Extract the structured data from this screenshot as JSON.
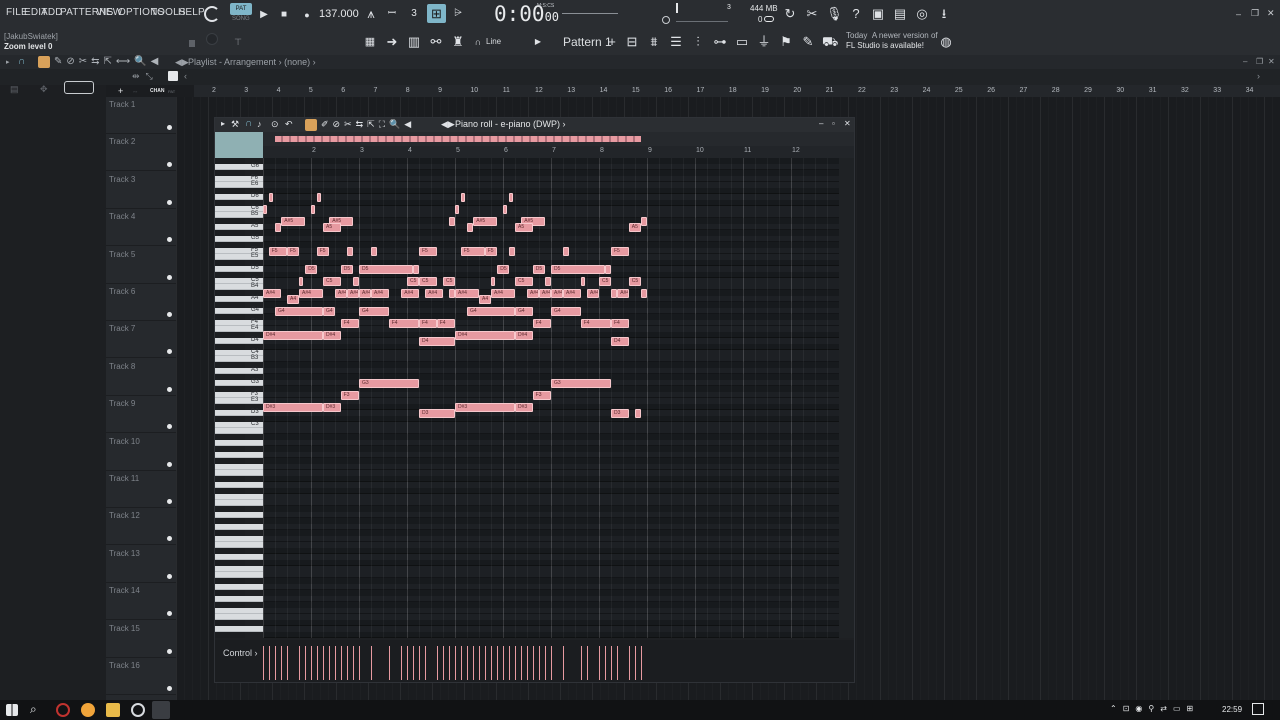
{
  "menu": [
    "FILE",
    "EDIT",
    "ADD",
    "PATTERNS",
    "VIEW",
    "OPTIONS",
    "TOOLS",
    "HELP"
  ],
  "transport": {
    "pat_label": "PAT",
    "song_label": "SONG",
    "tempo": "137.000",
    "time_main": "0:00",
    "time_sub": "00",
    "time_unit": "M:S:CS",
    "cpu_label": "3",
    "memory": "444 MB",
    "memory_sub": "0"
  },
  "hints": {
    "user": "[JakubSwiatek]",
    "status": "Zoom level 0"
  },
  "toolbar2": {
    "snap_label": "Line",
    "pattern_name": "Pattern 1",
    "news_date": "Today",
    "news_text_1": "A newer version of",
    "news_text_2": "FL Studio is available!"
  },
  "playlist": {
    "title": "Playlist - Arrangement",
    "separator": "›",
    "pattern": "(none)",
    "ruler": [
      "2",
      "3",
      "4",
      "5",
      "6",
      "7",
      "8",
      "9",
      "10",
      "11",
      "12",
      "13",
      "14",
      "15",
      "16",
      "17",
      "18",
      "19",
      "20",
      "21",
      "22",
      "23",
      "24",
      "25",
      "26",
      "27",
      "28",
      "29",
      "30",
      "31",
      "32",
      "33",
      "34"
    ],
    "tracks": [
      "Track 1",
      "Track 2",
      "Track 3",
      "Track 4",
      "Track 5",
      "Track 6",
      "Track 7",
      "Track 8",
      "Track 9",
      "Track 10",
      "Track 11",
      "Track 12",
      "Track 13",
      "Track 14",
      "Track 15",
      "Track 16"
    ]
  },
  "piano_roll": {
    "title": "Piano roll - e-piano (DWP)",
    "ruler": [
      "2",
      "3",
      "4",
      "5",
      "6",
      "7",
      "8",
      "9",
      "10",
      "11",
      "12"
    ],
    "control_label": "Control",
    "key_labels": [
      "G6",
      "F6",
      "E6",
      "D6",
      "C6",
      "B5",
      "A5",
      "G5",
      "F5",
      "E5",
      "D5",
      "C5",
      "B4",
      "A4",
      "G4",
      "F4",
      "E4",
      "D4",
      "C4",
      "B3",
      "A3",
      "G3",
      "F3",
      "E3",
      "D3",
      "C3"
    ],
    "notes": [
      {
        "pitch": "D6",
        "start": 1.12,
        "len": 0.08,
        "label": ""
      },
      {
        "pitch": "D6",
        "start": 2.12,
        "len": 0.08,
        "label": ""
      },
      {
        "pitch": "D6",
        "start": 5.12,
        "len": 0.08,
        "label": ""
      },
      {
        "pitch": "D6",
        "start": 6.12,
        "len": 0.08,
        "label": ""
      },
      {
        "pitch": "C6",
        "start": 1.0,
        "len": 0.08,
        "label": ""
      },
      {
        "pitch": "C6",
        "start": 2.0,
        "len": 0.08,
        "label": ""
      },
      {
        "pitch": "C6",
        "start": 5.0,
        "len": 0.08,
        "label": ""
      },
      {
        "pitch": "C6",
        "start": 6.0,
        "len": 0.08,
        "label": ""
      },
      {
        "pitch": "A#5",
        "start": 1.38,
        "len": 0.5,
        "label": "A#5"
      },
      {
        "pitch": "A#5",
        "start": 2.38,
        "len": 0.5,
        "label": "A#5"
      },
      {
        "pitch": "A#5",
        "start": 4.88,
        "len": 0.12,
        "label": ""
      },
      {
        "pitch": "A#5",
        "start": 5.38,
        "len": 0.5,
        "label": "A#5"
      },
      {
        "pitch": "A#5",
        "start": 6.38,
        "len": 0.5,
        "label": "A#5"
      },
      {
        "pitch": "A#5",
        "start": 8.88,
        "len": 0.12,
        "label": ""
      },
      {
        "pitch": "A5",
        "start": 1.25,
        "len": 0.12,
        "label": ""
      },
      {
        "pitch": "A5",
        "start": 2.25,
        "len": 0.38,
        "label": "A5"
      },
      {
        "pitch": "A5",
        "start": 5.25,
        "len": 0.12,
        "label": ""
      },
      {
        "pitch": "A5",
        "start": 6.25,
        "len": 0.38,
        "label": "A5"
      },
      {
        "pitch": "A5",
        "start": 8.62,
        "len": 0.25,
        "label": "A5"
      },
      {
        "pitch": "F5",
        "start": 1.12,
        "len": 0.38,
        "label": "F5"
      },
      {
        "pitch": "F5",
        "start": 1.5,
        "len": 0.25,
        "label": "F5"
      },
      {
        "pitch": "F5",
        "start": 2.12,
        "len": 0.25,
        "label": "F5"
      },
      {
        "pitch": "F5",
        "start": 2.75,
        "len": 0.12,
        "label": ""
      },
      {
        "pitch": "F5",
        "start": 3.25,
        "len": 0.12,
        "label": ""
      },
      {
        "pitch": "F5",
        "start": 4.25,
        "len": 0.38,
        "label": "F5"
      },
      {
        "pitch": "F5",
        "start": 5.12,
        "len": 0.5,
        "label": "F5"
      },
      {
        "pitch": "F5",
        "start": 5.62,
        "len": 0.25,
        "label": "F5"
      },
      {
        "pitch": "F5",
        "start": 6.12,
        "len": 0.12,
        "label": ""
      },
      {
        "pitch": "F5",
        "start": 7.25,
        "len": 0.12,
        "label": ""
      },
      {
        "pitch": "F5",
        "start": 8.25,
        "len": 0.38,
        "label": "F5"
      },
      {
        "pitch": "D5",
        "start": 1.88,
        "len": 0.25,
        "label": "D5"
      },
      {
        "pitch": "D5",
        "start": 2.62,
        "len": 0.25,
        "label": "D5"
      },
      {
        "pitch": "D5",
        "start": 3.0,
        "len": 1.12,
        "label": "D5"
      },
      {
        "pitch": "D5",
        "start": 4.12,
        "len": 0.12,
        "label": ""
      },
      {
        "pitch": "D5",
        "start": 5.88,
        "len": 0.25,
        "label": "D5"
      },
      {
        "pitch": "D5",
        "start": 6.62,
        "len": 0.25,
        "label": "D5"
      },
      {
        "pitch": "D5",
        "start": 7.0,
        "len": 1.12,
        "label": "D5"
      },
      {
        "pitch": "D5",
        "start": 8.12,
        "len": 0.12,
        "label": ""
      },
      {
        "pitch": "C5",
        "start": 1.75,
        "len": 0.08,
        "label": ""
      },
      {
        "pitch": "C5",
        "start": 2.25,
        "len": 0.38,
        "label": "C5"
      },
      {
        "pitch": "C5",
        "start": 2.88,
        "len": 0.12,
        "label": ""
      },
      {
        "pitch": "C5",
        "start": 4.0,
        "len": 0.25,
        "label": "C5"
      },
      {
        "pitch": "C5",
        "start": 4.25,
        "len": 0.38,
        "label": "C5"
      },
      {
        "pitch": "C5",
        "start": 4.75,
        "len": 0.25,
        "label": "C5"
      },
      {
        "pitch": "C5",
        "start": 5.75,
        "len": 0.08,
        "label": ""
      },
      {
        "pitch": "C5",
        "start": 6.25,
        "len": 0.38,
        "label": "C5"
      },
      {
        "pitch": "C5",
        "start": 6.88,
        "len": 0.12,
        "label": ""
      },
      {
        "pitch": "C5",
        "start": 7.62,
        "len": 0.08,
        "label": ""
      },
      {
        "pitch": "C5",
        "start": 8.0,
        "len": 0.25,
        "label": "C5"
      },
      {
        "pitch": "C5",
        "start": 8.62,
        "len": 0.25,
        "label": "C5"
      },
      {
        "pitch": "A#4",
        "start": 1.0,
        "len": 0.38,
        "label": "A#4"
      },
      {
        "pitch": "A#4",
        "start": 1.75,
        "len": 0.5,
        "label": "A#4"
      },
      {
        "pitch": "A#4",
        "start": 2.5,
        "len": 0.25,
        "label": "A#4"
      },
      {
        "pitch": "A#4",
        "start": 2.75,
        "len": 0.25,
        "label": "A#4"
      },
      {
        "pitch": "A#4",
        "start": 3.0,
        "len": 0.25,
        "label": "A#4"
      },
      {
        "pitch": "A#4",
        "start": 3.25,
        "len": 0.38,
        "label": "A#4"
      },
      {
        "pitch": "A#4",
        "start": 3.88,
        "len": 0.38,
        "label": "A#4"
      },
      {
        "pitch": "A#4",
        "start": 4.38,
        "len": 0.38,
        "label": "A#4"
      },
      {
        "pitch": "A#4",
        "start": 4.88,
        "len": 0.12,
        "label": ""
      },
      {
        "pitch": "A#4",
        "start": 5.0,
        "len": 0.5,
        "label": "A#4"
      },
      {
        "pitch": "A#4",
        "start": 5.75,
        "len": 0.5,
        "label": "A#4"
      },
      {
        "pitch": "A#4",
        "start": 6.5,
        "len": 0.25,
        "label": "A#4"
      },
      {
        "pitch": "A#4",
        "start": 6.75,
        "len": 0.25,
        "label": "A#4"
      },
      {
        "pitch": "A#4",
        "start": 7.0,
        "len": 0.25,
        "label": "A#4"
      },
      {
        "pitch": "A#4",
        "start": 7.25,
        "len": 0.38,
        "label": "A#4"
      },
      {
        "pitch": "A#4",
        "start": 7.75,
        "len": 0.25,
        "label": "A#4"
      },
      {
        "pitch": "A#4",
        "start": 8.25,
        "len": 0.12,
        "label": ""
      },
      {
        "pitch": "A#4",
        "start": 8.38,
        "len": 0.25,
        "label": "A#4"
      },
      {
        "pitch": "A#4",
        "start": 8.88,
        "len": 0.12,
        "label": ""
      },
      {
        "pitch": "A4",
        "start": 1.5,
        "len": 0.25,
        "label": "A4"
      },
      {
        "pitch": "A4",
        "start": 5.5,
        "len": 0.25,
        "label": "A4"
      },
      {
        "pitch": "G4",
        "start": 1.25,
        "len": 1.0,
        "label": "G4"
      },
      {
        "pitch": "G4",
        "start": 2.25,
        "len": 0.25,
        "label": "G4"
      },
      {
        "pitch": "G4",
        "start": 3.0,
        "len": 0.62,
        "label": "G4"
      },
      {
        "pitch": "G4",
        "start": 5.25,
        "len": 1.0,
        "label": "G4"
      },
      {
        "pitch": "G4",
        "start": 6.25,
        "len": 0.38,
        "label": "G4"
      },
      {
        "pitch": "G4",
        "start": 7.0,
        "len": 0.62,
        "label": "G4"
      },
      {
        "pitch": "F4",
        "start": 2.62,
        "len": 0.38,
        "label": "F4"
      },
      {
        "pitch": "F4",
        "start": 3.62,
        "len": 0.62,
        "label": "F4"
      },
      {
        "pitch": "F4",
        "start": 4.25,
        "len": 0.38,
        "label": "F4"
      },
      {
        "pitch": "F4",
        "start": 4.62,
        "len": 0.38,
        "label": "F4"
      },
      {
        "pitch": "F4",
        "start": 6.62,
        "len": 0.38,
        "label": "F4"
      },
      {
        "pitch": "F4",
        "start": 7.62,
        "len": 0.62,
        "label": "F4"
      },
      {
        "pitch": "F4",
        "start": 8.25,
        "len": 0.38,
        "label": "F4"
      },
      {
        "pitch": "D#4",
        "start": 1.0,
        "len": 1.25,
        "label": "D#4"
      },
      {
        "pitch": "D#4",
        "start": 2.25,
        "len": 0.38,
        "label": "D#4"
      },
      {
        "pitch": "D#4",
        "start": 5.0,
        "len": 1.25,
        "label": "D#4"
      },
      {
        "pitch": "D#4",
        "start": 6.25,
        "len": 0.38,
        "label": "D#4"
      },
      {
        "pitch": "D4",
        "start": 4.25,
        "len": 0.75,
        "label": "D4"
      },
      {
        "pitch": "D4",
        "start": 8.25,
        "len": 0.38,
        "label": "D4"
      },
      {
        "pitch": "G3",
        "start": 3.0,
        "len": 1.25,
        "label": "G3"
      },
      {
        "pitch": "G3",
        "start": 7.0,
        "len": 1.25,
        "label": "G3"
      },
      {
        "pitch": "F3",
        "start": 2.62,
        "len": 0.38,
        "label": "F3"
      },
      {
        "pitch": "F3",
        "start": 6.62,
        "len": 0.38,
        "label": "F3"
      },
      {
        "pitch": "D#3",
        "start": 1.0,
        "len": 1.25,
        "label": "D#3"
      },
      {
        "pitch": "D#3",
        "start": 2.25,
        "len": 0.38,
        "label": "D#3"
      },
      {
        "pitch": "D#3",
        "start": 5.0,
        "len": 1.25,
        "label": "D#3"
      },
      {
        "pitch": "D#3",
        "start": 6.25,
        "len": 0.38,
        "label": "D#3"
      },
      {
        "pitch": "D3",
        "start": 4.25,
        "len": 0.75,
        "label": "D3"
      },
      {
        "pitch": "D3",
        "start": 8.25,
        "len": 0.38,
        "label": "D3"
      },
      {
        "pitch": "D3",
        "start": 8.75,
        "len": 0.12,
        "label": ""
      }
    ]
  },
  "taskbar": {
    "clock": "22:59"
  },
  "colors": {
    "note_fill": "#e79aa1",
    "accent": "#7fb6c9"
  }
}
